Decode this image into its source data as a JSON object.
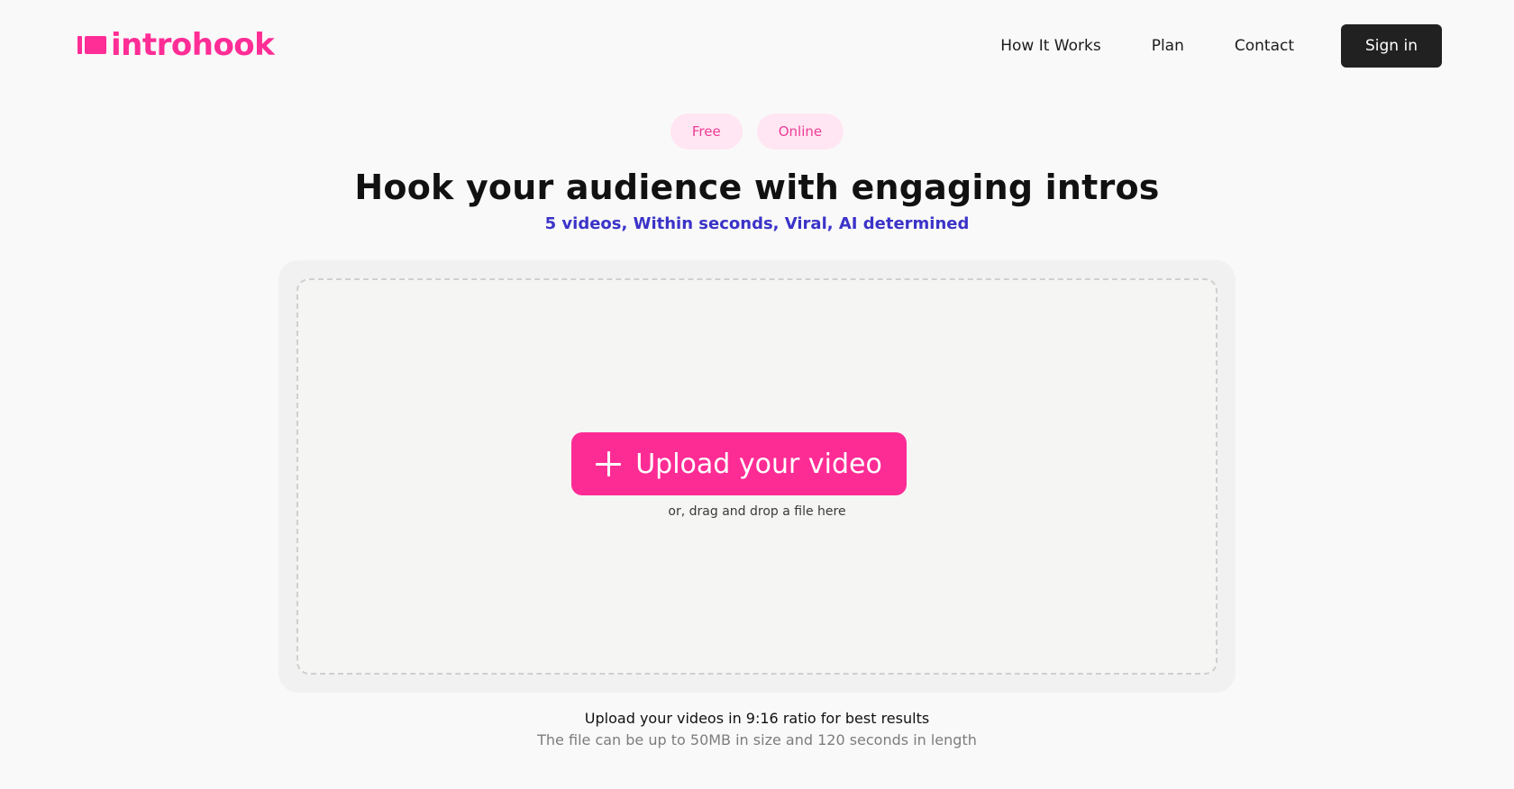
{
  "brand": {
    "name": "introhook",
    "accent": "#ff2d96"
  },
  "nav": {
    "links": [
      "How It Works",
      "Plan",
      "Contact"
    ],
    "signin_label": "Sign in"
  },
  "badges": [
    "Free",
    "Online"
  ],
  "hero": {
    "title": "Hook your audience with engaging intros",
    "subtitle": "5 videos, Within seconds, Viral, AI determined"
  },
  "upload": {
    "button_label": "Upload your video",
    "icon": "plus-icon",
    "hint": "or, drag and drop a file here"
  },
  "notes": {
    "ratio": "Upload your videos in 9:16 ratio for best results",
    "limits": "The file can be up to 50MB in size and 120 seconds in length"
  },
  "colors": {
    "upload_button": "#fd2c95",
    "badge_bg": "#ffe6f2",
    "subtitle": "#3b33c8",
    "signin_bg": "#212121"
  }
}
